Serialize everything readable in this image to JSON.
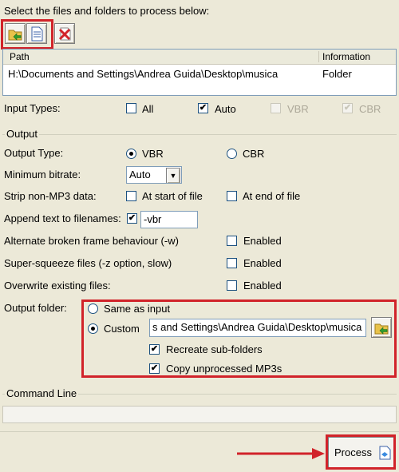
{
  "header": {
    "prompt": "Select the files and folders to process below:"
  },
  "toolbar": {
    "icons": [
      "folder-add-icon",
      "document-icon",
      "remove-icon"
    ]
  },
  "file_list": {
    "columns": [
      "Path",
      "Information"
    ],
    "rows": [
      {
        "path": "H:\\Documents and Settings\\Andrea Guida\\Desktop\\musica",
        "info": "Folder"
      }
    ]
  },
  "input_types": {
    "label": "Input Types:",
    "all": {
      "label": "All",
      "checked": false
    },
    "auto": {
      "label": "Auto",
      "checked": true
    },
    "vbr": {
      "label": "VBR",
      "checked": false,
      "disabled": true
    },
    "cbr": {
      "label": "CBR",
      "checked": true,
      "disabled": true
    }
  },
  "output": {
    "group_label": "Output",
    "output_type_label": "Output Type:",
    "vbr_label": "VBR",
    "cbr_label": "CBR",
    "min_bitrate_label": "Minimum bitrate:",
    "min_bitrate_value": "Auto",
    "strip_label": "Strip non-MP3 data:",
    "strip_start_label": "At start of file",
    "strip_end_label": "At end of file",
    "append_label": "Append text to filenames:",
    "append_value": "-vbr",
    "alt_broken_label": "Alternate broken frame behaviour (-w)",
    "super_squeeze_label": "Super-squeeze files (-z option, slow)",
    "overwrite_label": "Overwrite existing files:",
    "enabled_label": "Enabled",
    "output_folder_label": "Output folder:",
    "same_as_input_label": "Same as input",
    "custom_label": "Custom",
    "custom_path": "s and Settings\\Andrea Guida\\Desktop\\musica",
    "recreate_label": "Recreate sub-folders",
    "copy_label": "Copy unprocessed MP3s"
  },
  "command_line": {
    "label": "Command Line",
    "value": ""
  },
  "process_button": {
    "label": "Process"
  },
  "colors": {
    "highlight": "#d1232a",
    "background": "#ece9d8"
  }
}
